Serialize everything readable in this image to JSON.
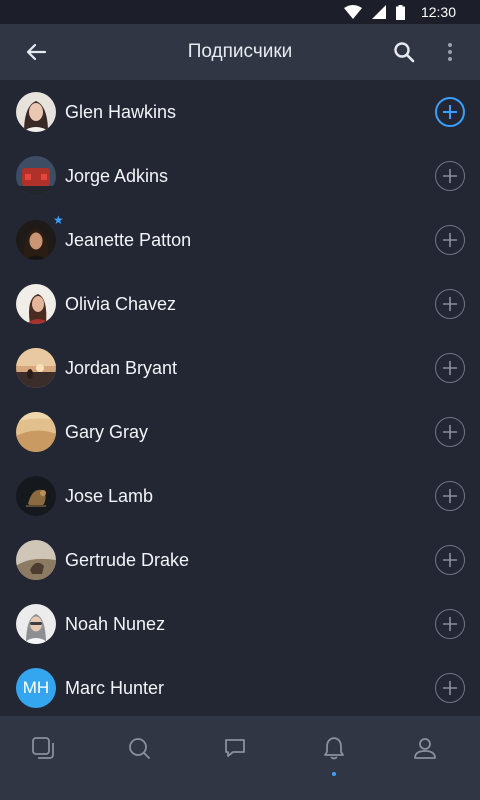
{
  "status": {
    "time": "12:30"
  },
  "header": {
    "title": "Подписчики"
  },
  "followers": [
    {
      "name": "Glen Hawkins",
      "avatar": "photo"
    },
    {
      "name": "Jorge Adkins",
      "avatar": "photo"
    },
    {
      "name": "Jeanette Patton",
      "avatar": "photo",
      "starred": true
    },
    {
      "name": "Olivia Chavez",
      "avatar": "photo"
    },
    {
      "name": "Jordan Bryant",
      "avatar": "photo"
    },
    {
      "name": "Gary Gray",
      "avatar": "photo"
    },
    {
      "name": "Jose Lamb",
      "avatar": "photo"
    },
    {
      "name": "Gertrude Drake",
      "avatar": "photo"
    },
    {
      "name": "Noah Nunez",
      "avatar": "photo"
    },
    {
      "name": "Marc Hunter",
      "avatar": "initials",
      "initials": "MH"
    }
  ],
  "colors": {
    "accent": "#3aa0ff",
    "background": "#232733",
    "bar": "#303644"
  },
  "bottom_nav": {
    "items": [
      "feed-icon",
      "search-icon",
      "messages-icon",
      "notifications-icon",
      "profile-icon"
    ],
    "active": "notifications-icon"
  }
}
